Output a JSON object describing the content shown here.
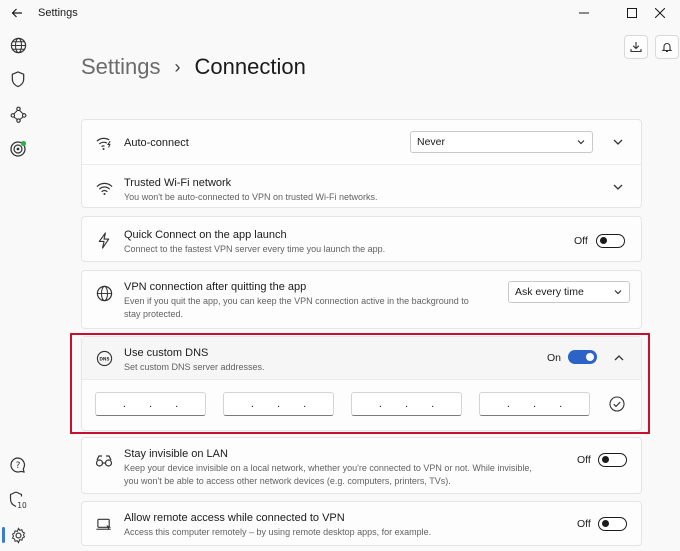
{
  "window": {
    "title": "Settings",
    "controls": [
      "minimize",
      "maximize",
      "close"
    ]
  },
  "rail": {
    "items": [
      "globe-icon",
      "shield-icon",
      "meshnet-icon",
      "threat-protection-icon",
      "help-icon",
      "shield-10-icon",
      "settings-icon"
    ],
    "shield_badge": "10",
    "active": "settings-icon"
  },
  "breadcrumb": {
    "parent": "Settings",
    "separator": "›",
    "current": "Connection"
  },
  "settings": {
    "auto_connect": {
      "title": "Auto-connect",
      "select_value": "Never"
    },
    "trusted_wifi": {
      "title": "Trusted Wi-Fi network",
      "description": "You won't be auto-connected to VPN on trusted Wi-Fi networks."
    },
    "quick_connect": {
      "title": "Quick Connect on the app launch",
      "description": "Connect to the fastest VPN server every time you launch the app.",
      "state_label": "Off"
    },
    "vpn_after_quit": {
      "title": "VPN connection after quitting the app",
      "description_line1": "Even if you quit the app, you can keep the VPN connection active in the background to",
      "description_line2": "stay protected.",
      "select_value": "Ask every time"
    },
    "custom_dns": {
      "title": "Use custom DNS",
      "description": "Set custom DNS server addresses.",
      "state_label": "On",
      "fields": [
        ". . .",
        ". . .",
        ". . .",
        ". . ."
      ]
    },
    "invisible_lan": {
      "title": "Stay invisible on LAN",
      "description_line1": "Keep your device invisible on a local network, whether you're connected to VPN or not. While invisible,",
      "description_line2": "you won't be able to access other network devices (e.g. computers, printers, TVs).",
      "state_label": "Off"
    },
    "remote_access": {
      "title": "Allow remote access while connected to VPN",
      "description": "Access this computer remotely – by using remote desktop apps, for example.",
      "state_label": "Off"
    }
  },
  "colors": {
    "accent": "#2c63c7",
    "highlight_border": "#c8102e",
    "background": "#f9f9f9",
    "card": "#fdfdfd"
  }
}
